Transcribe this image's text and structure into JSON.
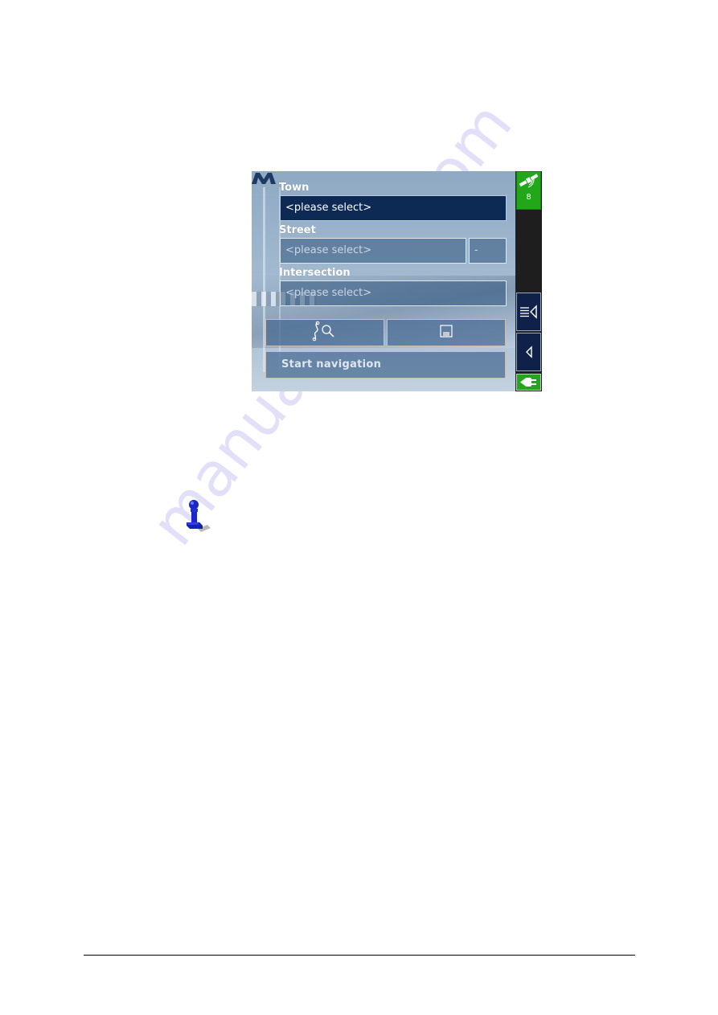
{
  "screen": {
    "logo_text": "M",
    "town": {
      "label": "Town",
      "value": "<please select>",
      "active": true
    },
    "street": {
      "label": "Street",
      "value": "<please select>",
      "house_number": "-"
    },
    "intersection": {
      "label": "Intersection",
      "value": "<please select>"
    },
    "buttons": {
      "route_search_icon": "route-search-icon",
      "save_icon": "save-icon",
      "start_navigation": "Start navigation"
    },
    "side_panel": {
      "gps_satellites": "8",
      "menu_icon": "menu-back-icon",
      "back_icon": "back-icon",
      "power_icon": "power-plug-icon"
    }
  },
  "colors": {
    "active_field_bg": "#0d2a55",
    "gps_green": "#23a71a",
    "side_button_bg": "#0f2148"
  },
  "watermark": "manualshive.com"
}
